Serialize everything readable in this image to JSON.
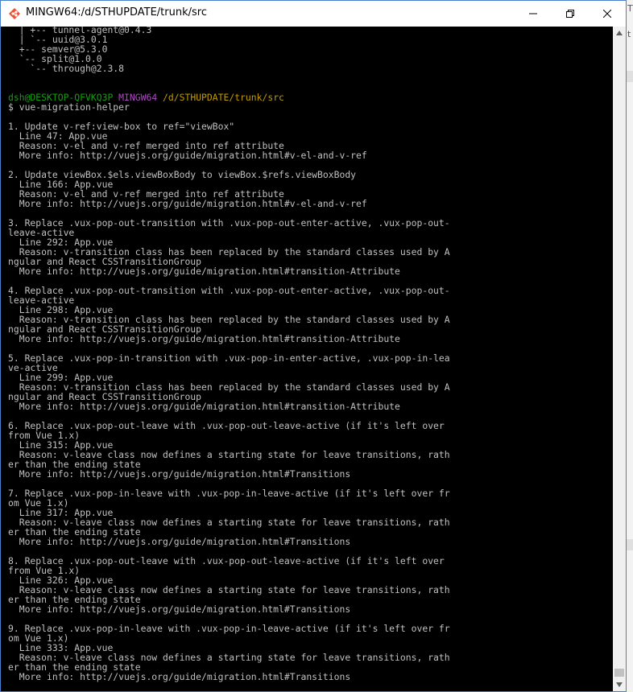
{
  "window": {
    "title": "MINGW64:/d/STHUPDATE/trunk/src"
  },
  "colors": {
    "prompt_user": "#13a10e",
    "prompt_host_env": "#b148c6",
    "prompt_path": "#c19c00",
    "text": "#c0c0c0",
    "background": "#000000"
  },
  "icons": {
    "app": "mingw-app-icon",
    "minimize": "minimize-icon",
    "maximize": "restore-icon",
    "close": "close-icon"
  },
  "terminal": {
    "tree_lines": [
      "  | +-- tunnel-agent@0.4.3",
      "  | `-- uuid@3.0.1",
      "  +-- semver@5.3.0",
      "  `-- split@1.0.0",
      "    `-- through@2.3.8"
    ],
    "prompt": {
      "user": "dsh@DESKTOP-QFVKQ3P",
      "env": "MINGW64",
      "path": "/d/STHUPDATE/trunk/src"
    },
    "command": "$ vue-migration-helper",
    "output": [
      "1. Update v-ref:view-box to ref=\"viewBox\"",
      "  Line 47: App.vue",
      "  Reason: v-el and v-ref merged into ref attribute",
      "  More info: http://vuejs.org/guide/migration.html#v-el-and-v-ref",
      "",
      "2. Update viewBox.$els.viewBoxBody to viewBox.$refs.viewBoxBody",
      "  Line 166: App.vue",
      "  Reason: v-el and v-ref merged into ref attribute",
      "  More info: http://vuejs.org/guide/migration.html#v-el-and-v-ref",
      "",
      "3. Replace .vux-pop-out-transition with .vux-pop-out-enter-active, .vux-pop-out-",
      "leave-active",
      "  Line 292: App.vue",
      "  Reason: v-transition class has been replaced by the standard classes used by A",
      "ngular and React CSSTransitionGroup",
      "  More info: http://vuejs.org/guide/migration.html#transition-Attribute",
      "",
      "4. Replace .vux-pop-out-transition with .vux-pop-out-enter-active, .vux-pop-out-",
      "leave-active",
      "  Line 298: App.vue",
      "  Reason: v-transition class has been replaced by the standard classes used by A",
      "ngular and React CSSTransitionGroup",
      "  More info: http://vuejs.org/guide/migration.html#transition-Attribute",
      "",
      "5. Replace .vux-pop-in-transition with .vux-pop-in-enter-active, .vux-pop-in-lea",
      "ve-active",
      "  Line 299: App.vue",
      "  Reason: v-transition class has been replaced by the standard classes used by A",
      "ngular and React CSSTransitionGroup",
      "  More info: http://vuejs.org/guide/migration.html#transition-Attribute",
      "",
      "6. Replace .vux-pop-out-leave with .vux-pop-out-leave-active (if it's left over",
      "from Vue 1.x)",
      "  Line 315: App.vue",
      "  Reason: v-leave class now defines a starting state for leave transitions, rath",
      "er than the ending state",
      "  More info: http://vuejs.org/guide/migration.html#Transitions",
      "",
      "7. Replace .vux-pop-in-leave with .vux-pop-in-leave-active (if it's left over fr",
      "om Vue 1.x)",
      "  Line 317: App.vue",
      "  Reason: v-leave class now defines a starting state for leave transitions, rath",
      "er than the ending state",
      "  More info: http://vuejs.org/guide/migration.html#Transitions",
      "",
      "8. Replace .vux-pop-out-leave with .vux-pop-out-leave-active (if it's left over",
      "from Vue 1.x)",
      "  Line 326: App.vue",
      "  Reason: v-leave class now defines a starting state for leave transitions, rath",
      "er than the ending state",
      "  More info: http://vuejs.org/guide/migration.html#Transitions",
      "",
      "9. Replace .vux-pop-in-leave with .vux-pop-in-leave-active (if it's left over fr",
      "om Vue 1.x)",
      "  Line 333: App.vue",
      "  Reason: v-leave class now defines a starting state for leave transitions, rath",
      "er than the ending state",
      "  More info: http://vuejs.org/guide/migration.html#Transitions"
    ]
  }
}
